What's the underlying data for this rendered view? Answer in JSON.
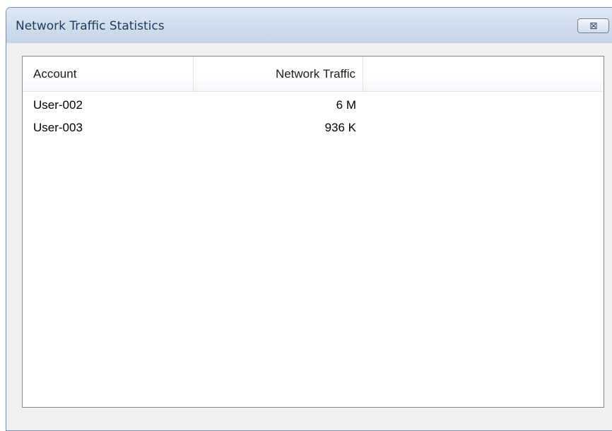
{
  "window": {
    "title": "Network Traffic Statistics",
    "close_glyph": "⊠"
  },
  "table": {
    "columns": [
      "Account",
      "Network Traffic"
    ],
    "rows": [
      {
        "account": "User-002",
        "traffic": "6 M"
      },
      {
        "account": "User-003",
        "traffic": "936 K"
      }
    ]
  }
}
